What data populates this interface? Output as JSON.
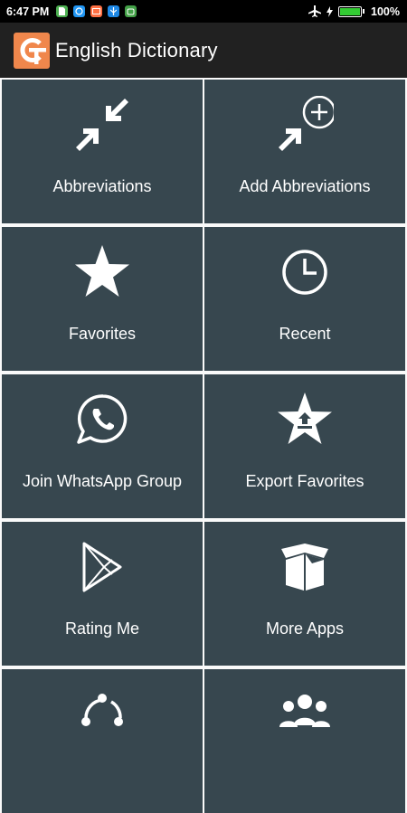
{
  "status_bar": {
    "time": "6:47 PM",
    "battery": "100%",
    "battery_level": 1.0,
    "notification_icons": [
      "sim-card-icon",
      "browser-icon",
      "message-icon",
      "vpn-icon",
      "robot-icon"
    ]
  },
  "app_bar": {
    "title": "English Dictionary",
    "background": "#212121",
    "logo_color": "#f0874c"
  },
  "colors": {
    "tile": "#37474f",
    "grid_lines": "#fafafa"
  },
  "tiles": [
    {
      "label": "Abbreviations",
      "icon": "compress-arrows-icon"
    },
    {
      "label": "Add Abbreviations",
      "icon": "add-abbreviation-icon"
    },
    {
      "label": "Favorites",
      "icon": "star-icon"
    },
    {
      "label": "Recent",
      "icon": "clock-icon"
    },
    {
      "label": "Join WhatsApp Group",
      "icon": "whatsapp-icon"
    },
    {
      "label": "Export Favorites",
      "icon": "star-upload-icon"
    },
    {
      "label": "Rating Me",
      "icon": "play-store-icon"
    },
    {
      "label": "More Apps",
      "icon": "open-box-icon"
    },
    {
      "label": "",
      "icon": "share-icon"
    },
    {
      "label": "",
      "icon": "group-icon"
    }
  ]
}
